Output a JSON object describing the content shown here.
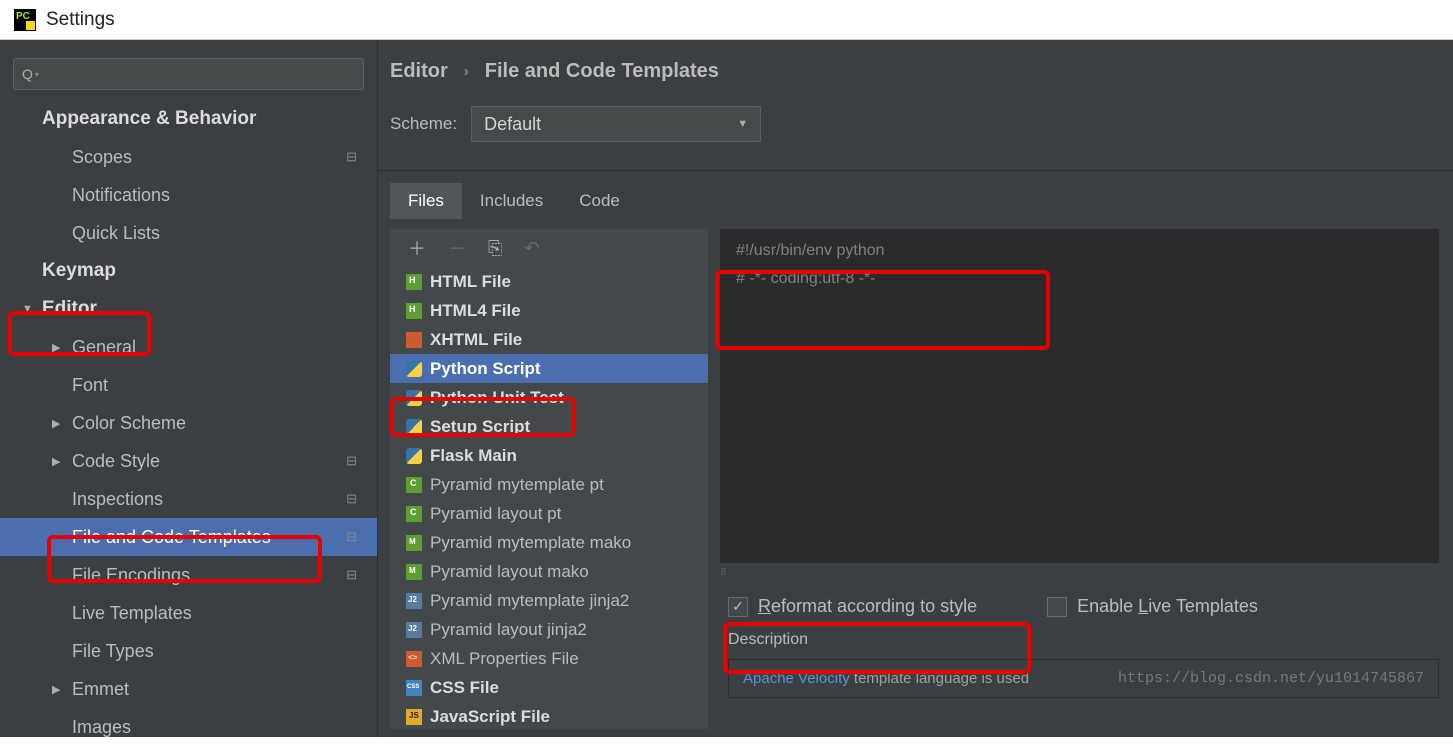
{
  "window": {
    "title": "Settings"
  },
  "breadcrumb": {
    "root": "Editor",
    "leaf": "File and Code Templates"
  },
  "scheme": {
    "label": "Scheme:",
    "value": "Default"
  },
  "sidebar": {
    "items": [
      {
        "label": "Appearance & Behavior",
        "level": 0,
        "bold": true
      },
      {
        "label": "Scopes",
        "level": 1,
        "suffix": true
      },
      {
        "label": "Notifications",
        "level": 1
      },
      {
        "label": "Quick Lists",
        "level": 1
      },
      {
        "label": "Keymap",
        "level": 0,
        "bold": true
      },
      {
        "label": "Editor",
        "level": 0,
        "bold": true,
        "arrow": "down"
      },
      {
        "label": "General",
        "level": 1,
        "arrow": "right"
      },
      {
        "label": "Font",
        "level": 1
      },
      {
        "label": "Color Scheme",
        "level": 1,
        "arrow": "right"
      },
      {
        "label": "Code Style",
        "level": 1,
        "arrow": "right",
        "suffix": true
      },
      {
        "label": "Inspections",
        "level": 1,
        "suffix": true
      },
      {
        "label": "File and Code Templates",
        "level": 1,
        "selected": true,
        "suffix": true
      },
      {
        "label": "File Encodings",
        "level": 1,
        "suffix": true
      },
      {
        "label": "Live Templates",
        "level": 1
      },
      {
        "label": "File Types",
        "level": 1
      },
      {
        "label": "Emmet",
        "level": 1,
        "arrow": "right"
      },
      {
        "label": "Images",
        "level": 1
      }
    ]
  },
  "tabs": [
    {
      "label": "Files",
      "active": true
    },
    {
      "label": "Includes",
      "active": false
    },
    {
      "label": "Code",
      "active": false
    }
  ],
  "templates": [
    {
      "label": "HTML File",
      "icon": "html",
      "bold": true
    },
    {
      "label": "HTML4 File",
      "icon": "html",
      "bold": true
    },
    {
      "label": "XHTML File",
      "icon": "xhtml",
      "bold": true
    },
    {
      "label": "Python Script",
      "icon": "py",
      "bold": true,
      "selected": true
    },
    {
      "label": "Python Unit Test",
      "icon": "py",
      "bold": true
    },
    {
      "label": "Setup Script",
      "icon": "py",
      "bold": true
    },
    {
      "label": "Flask Main",
      "icon": "py",
      "bold": true
    },
    {
      "label": "Pyramid mytemplate pt",
      "icon": "c"
    },
    {
      "label": "Pyramid layout pt",
      "icon": "c"
    },
    {
      "label": "Pyramid mytemplate mako",
      "icon": "m"
    },
    {
      "label": "Pyramid layout mako",
      "icon": "m"
    },
    {
      "label": "Pyramid mytemplate jinja2",
      "icon": "j2"
    },
    {
      "label": "Pyramid layout jinja2",
      "icon": "j2"
    },
    {
      "label": "XML Properties File",
      "icon": "xml"
    },
    {
      "label": "CSS File",
      "icon": "css",
      "bold": true
    },
    {
      "label": "JavaScript File",
      "icon": "js",
      "bold": true
    }
  ],
  "editor": {
    "line1": "#!/usr/bin/env python",
    "line2": "# -*- coding:utf-8 -*-"
  },
  "options": {
    "reformat": "eformat according to style",
    "liveTemplates": "Enable ",
    "liveTemplates2": "ive Templates"
  },
  "description": {
    "label": "Description",
    "link": "Apache Velocity",
    "text": " template language is used",
    "watermark": "https://blog.csdn.net/yu1014745867"
  }
}
